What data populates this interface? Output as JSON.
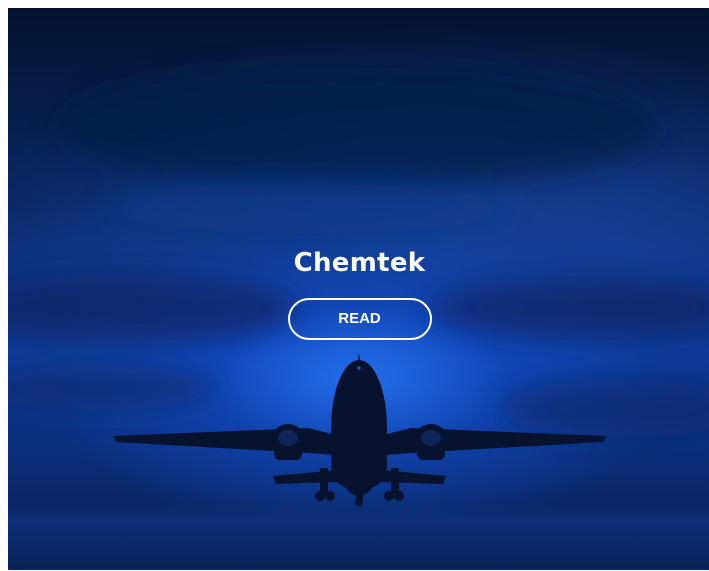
{
  "card": {
    "title": "Chemtek",
    "button_label": "READ",
    "background_image": "airplane-takeoff-night",
    "accent_color": "#0d3a98",
    "text_color": "#ffffff"
  }
}
